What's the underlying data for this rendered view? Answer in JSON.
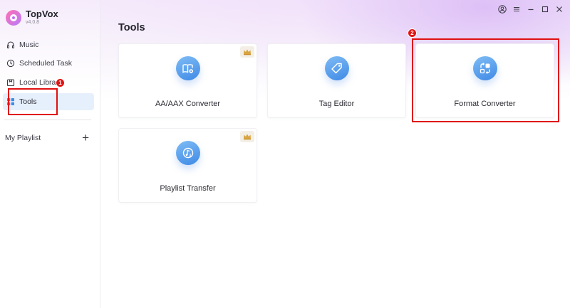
{
  "app": {
    "name": "TopVox",
    "version": "v4.0.8"
  },
  "sidebar": {
    "items": [
      {
        "label": "Music",
        "icon": "headphones-icon"
      },
      {
        "label": "Scheduled Task",
        "icon": "clock-icon"
      },
      {
        "label": "Local Librar",
        "icon": "library-icon"
      },
      {
        "label": "Tools",
        "icon": "grid-icon",
        "active": true
      }
    ],
    "playlist_label": "My Playlist",
    "add_playlist_icon": "plus-icon"
  },
  "window": {
    "controls": [
      "account-icon",
      "menu-icon",
      "minimize-icon",
      "maximize-icon",
      "close-icon"
    ]
  },
  "main": {
    "title": "Tools",
    "tools": [
      {
        "label": "AA/AAX Converter",
        "icon": "book-convert-icon",
        "premium": true
      },
      {
        "label": "Tag Editor",
        "icon": "tag-icon",
        "premium": false
      },
      {
        "label": "Format Converter",
        "icon": "format-convert-icon",
        "premium": false
      },
      {
        "label": "Playlist Transfer",
        "icon": "music-transfer-icon",
        "premium": true
      }
    ]
  },
  "annotations": {
    "step1": "1",
    "step2": "2",
    "color": "#e01010"
  },
  "colors": {
    "accent": "#3f8ae6",
    "active_bg": "#e6f0fc"
  }
}
